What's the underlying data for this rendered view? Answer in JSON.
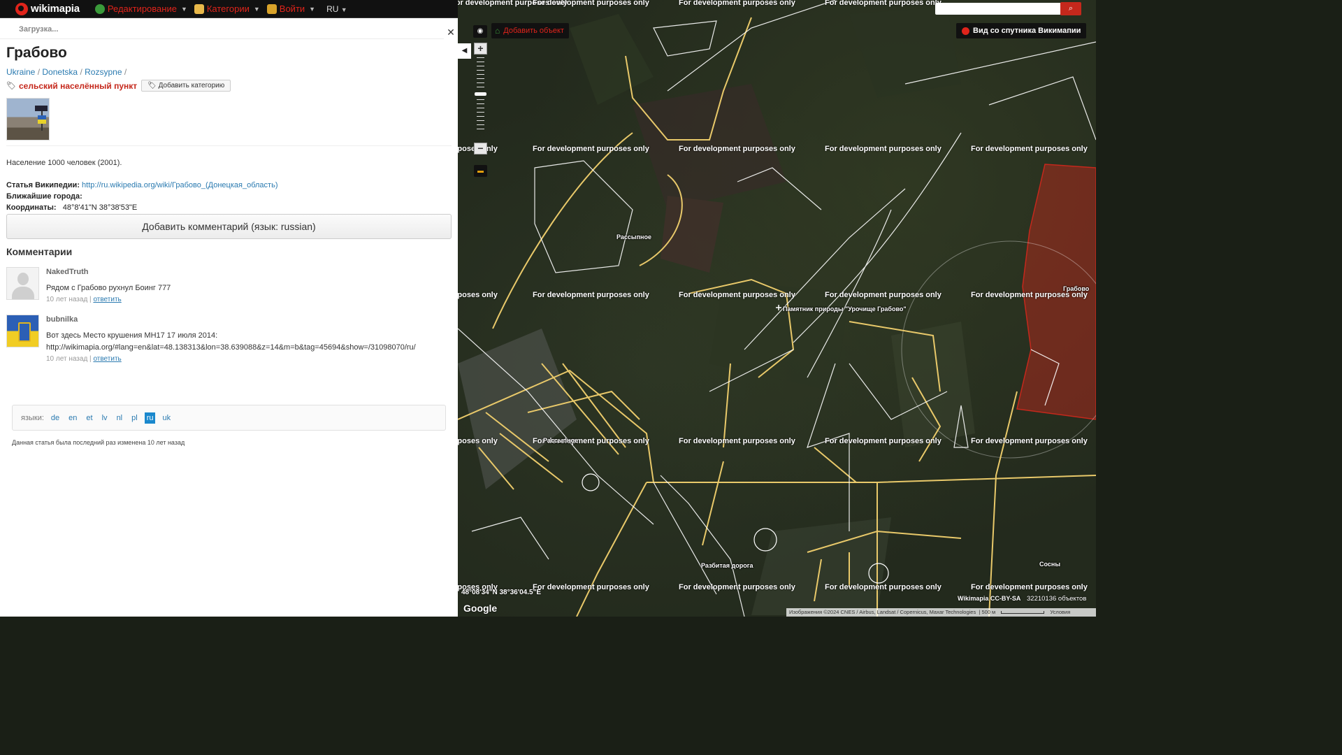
{
  "topbar": {
    "logo_text": "wikimapia",
    "menu": [
      {
        "label": "Редактирование",
        "icon": "globe-icon",
        "icon_color": "#3a9a3a"
      },
      {
        "label": "Категории",
        "icon": "categories-icon",
        "icon_color": "#e8b84a"
      },
      {
        "label": "Войти",
        "icon": "login-icon",
        "icon_color": "#d9a32a"
      }
    ],
    "language": "RU"
  },
  "panel": {
    "loading": "Загрузка...",
    "close_glyph": "✕",
    "title": "Грабово",
    "breadcrumbs": [
      "Ukraine",
      "Donetska",
      "Rozsypne"
    ],
    "breadcrumb_separator": "/",
    "category": "сельский населённый пункт",
    "add_category": "Добавить категорию",
    "population": "Население 1000 человек (2001).",
    "wiki_label": "Статья Википедии:",
    "wiki_url": "http://ru.wikipedia.org/wiki/Грабово_(Донецкая_область)",
    "nearby_label": "Ближайшие города:",
    "coords_label": "Координаты:",
    "coords_value": "48°8'41\"N   38°38'53\"E",
    "add_comment": "Добавить комментарий (язык: russian)",
    "comments_heading": "Комментарии",
    "comments": [
      {
        "author": "NakedTruth",
        "text": "Рядом с Грабово рухнул Боинг 777",
        "time": "10 лет назад",
        "reply": "ответить",
        "avatar": "default-avatar"
      },
      {
        "author": "bubnilka",
        "text": "Вот здесь Место крушения МН17 17 июля 2014:",
        "text2": "http://wikimapia.org/#lang=en&lat=48.138313&lon=38.639088&z=14&m=b&tag=45694&show=/31098070/ru/",
        "time": "10 лет назад",
        "reply": "ответить",
        "avatar": "ukraine-flag-avatar"
      }
    ],
    "languages_label": "языки:",
    "languages": [
      "de",
      "en",
      "et",
      "lv",
      "nl",
      "pl",
      "ru",
      "uk"
    ],
    "active_language": "ru",
    "modified": "Данная статья была последний раз изменена 10 лет назад"
  },
  "map": {
    "watermark": "For development purposes only",
    "add_object": "Добавить объект",
    "satellite_view": "Вид со спутника Викимапии",
    "places": [
      "Рассыпное",
      "Рассыпное",
      "Памятник природы \"Урочище Грабово\"",
      "Грабово",
      "Разбитая дорога",
      "Сосны"
    ],
    "cursor_coords": "48°08'34\"N 38°36'04.5\"E",
    "google": "Google",
    "license": "Wikimapia CC-BY-SA",
    "objects_count": "32210136 объектов",
    "attribution": "Изображения ©2024 CNES / Airbus, Landsat / Copernicus, Maxar Technologies",
    "scale": "500 м",
    "terms": "Условия",
    "road_color": "#e9c96a",
    "boundary_color": "#ffffff",
    "highlight_color": "#c5281c"
  }
}
